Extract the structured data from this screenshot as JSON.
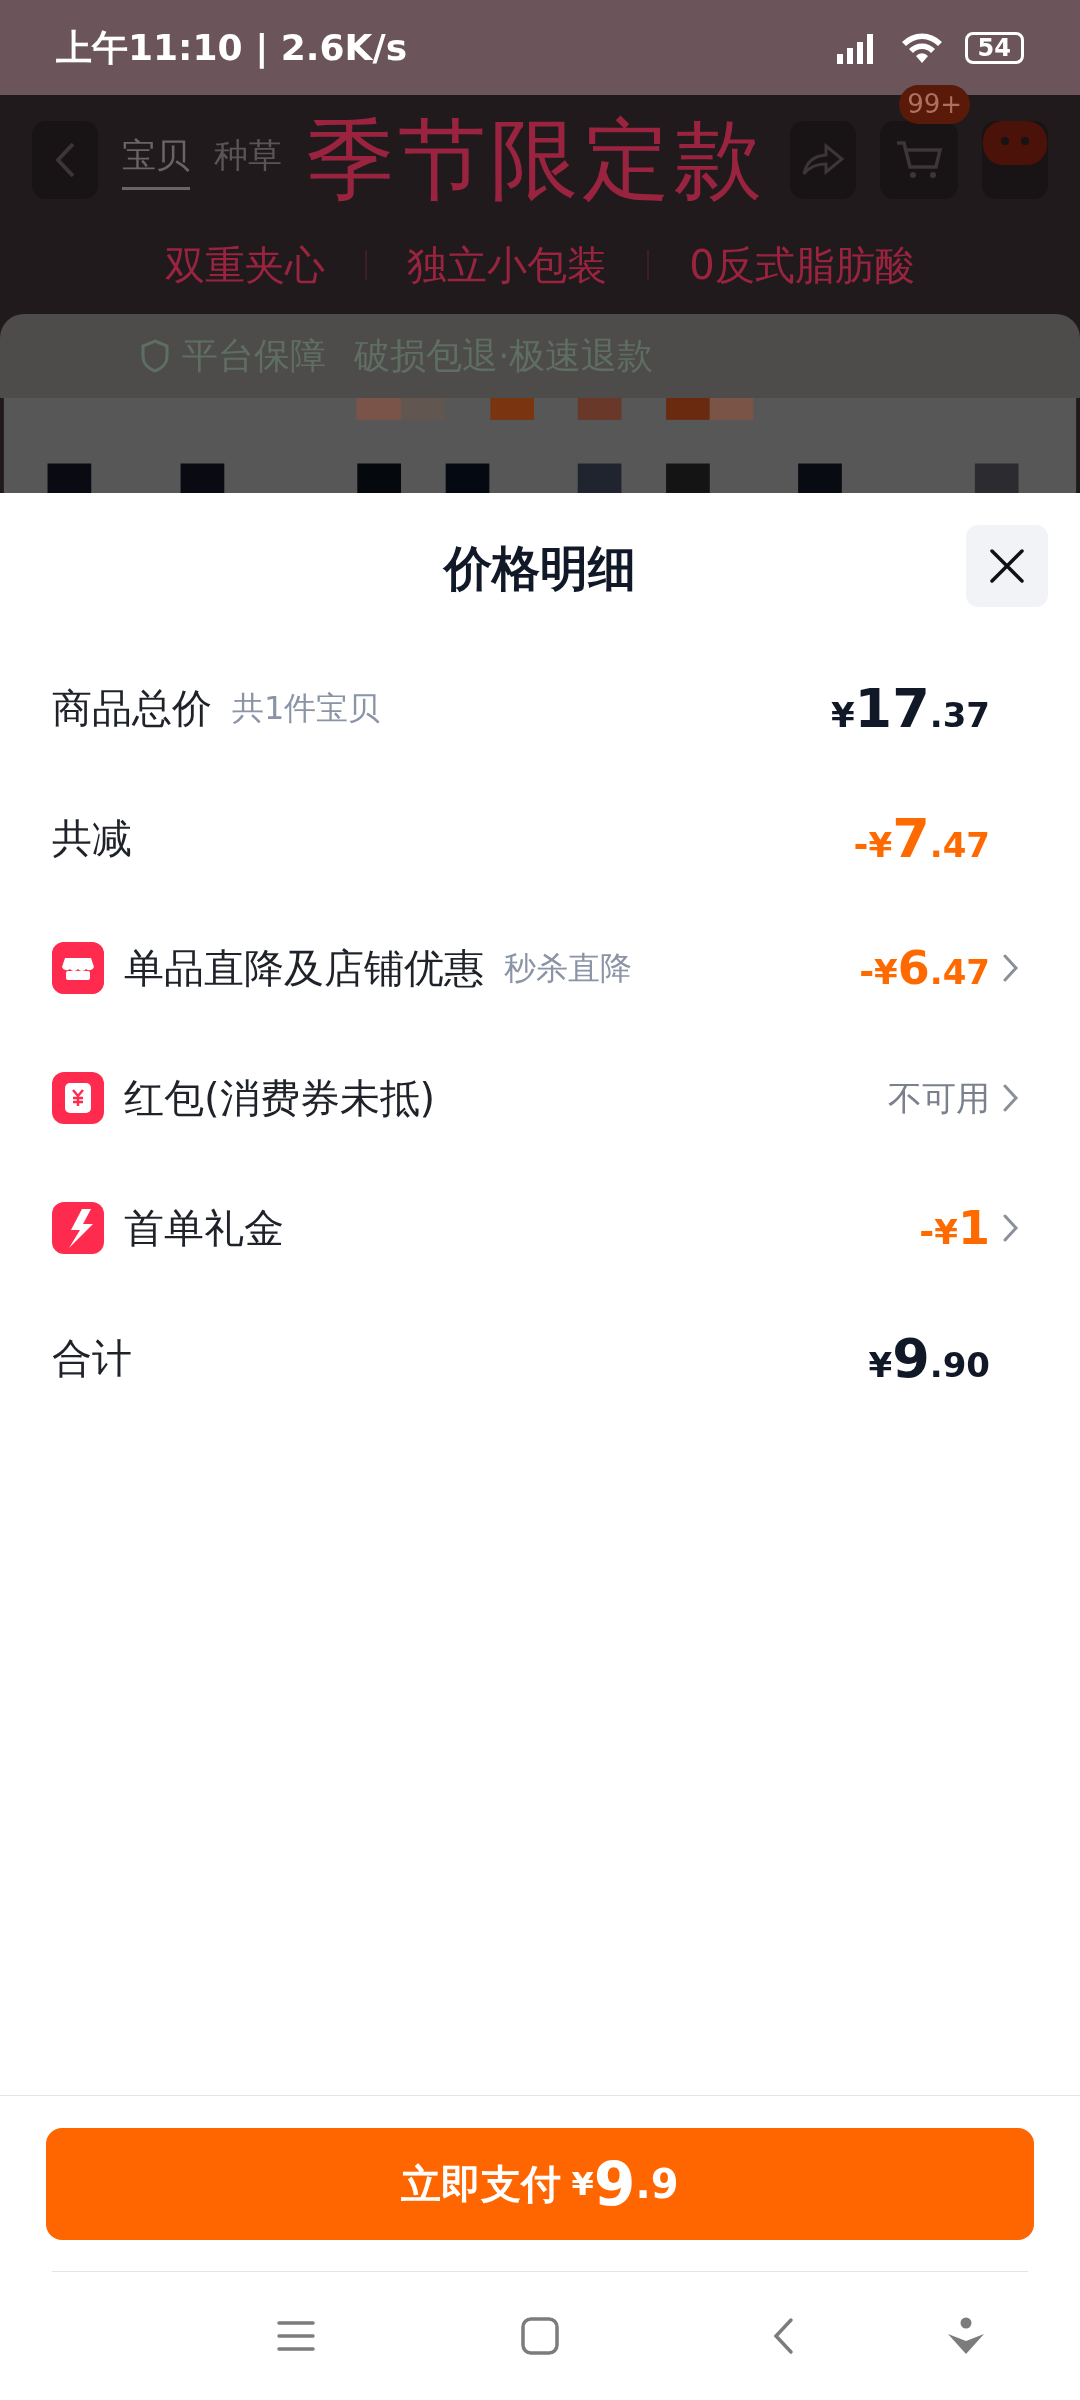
{
  "status_bar": {
    "time": "上午11:10 | 2.6K/s",
    "battery": "54"
  },
  "background_page": {
    "title": "季节限定款",
    "tabs": [
      {
        "label": "宝贝",
        "selected": true
      },
      {
        "label": "种草",
        "selected": false
      }
    ],
    "cart_badge": "99+",
    "features": [
      "双重夹心",
      "独立小包装",
      "0反式脂肪酸"
    ],
    "guarantee": "平台保障",
    "guarantee_detail": "破损包退·极速退款"
  },
  "sheet": {
    "title": "价格明细",
    "rows": [
      {
        "kind": "subtotal",
        "label": "商品总价",
        "note": "共1件宝贝",
        "amount": {
          "symbol": "¥",
          "integer": "17",
          "decimal": ".37"
        },
        "arrow": false
      },
      {
        "kind": "reduction",
        "label": "共减",
        "amount": {
          "sign": "-",
          "symbol": "¥",
          "integer": "7",
          "decimal": ".47"
        },
        "arrow": false
      },
      {
        "kind": "store",
        "label": "单品直降及店铺优惠",
        "note": "秒杀直降",
        "amount": {
          "sign": "-",
          "symbol": "¥",
          "integer": "6",
          "decimal": ".47"
        },
        "arrow": true
      },
      {
        "kind": "coupon",
        "label": "红包(消费券未抵)",
        "value": "不可用",
        "arrow": true
      },
      {
        "kind": "gift",
        "label": "首单礼金",
        "amount": {
          "sign": "-",
          "symbol": "¥",
          "integer": "1"
        },
        "arrow": true
      },
      {
        "kind": "total",
        "label": "合计",
        "amount": {
          "symbol": "¥",
          "integer": "9",
          "decimal": ".90"
        },
        "arrow": false
      }
    ]
  },
  "pay_button": {
    "label": "立即支付",
    "symbol": "¥",
    "integer": "9",
    "decimal": ".9"
  }
}
